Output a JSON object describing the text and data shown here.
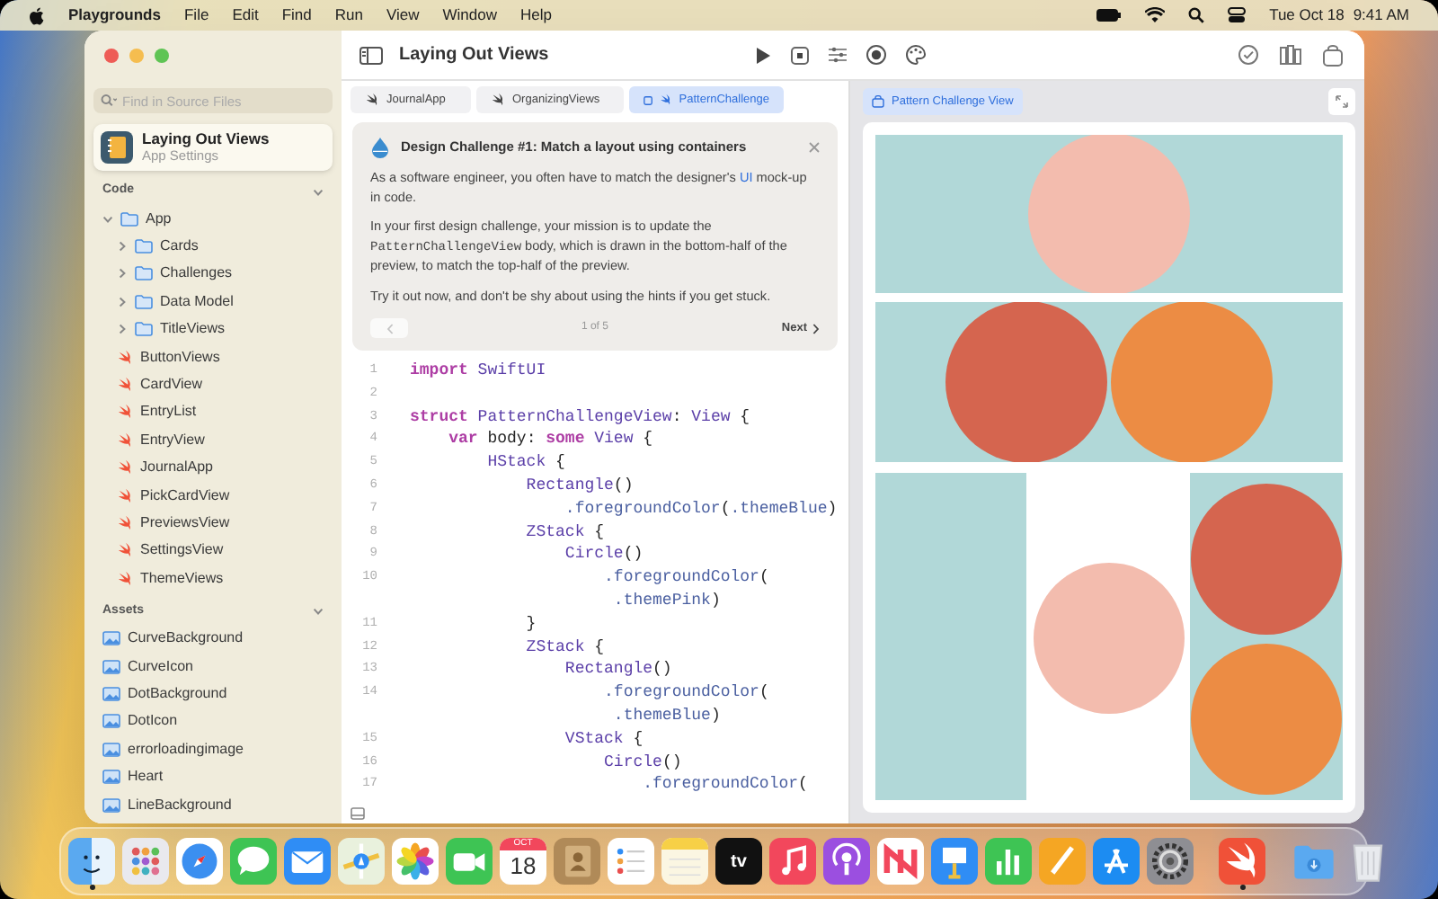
{
  "menu_bar": {
    "app_name": "Playgrounds",
    "menus": [
      "File",
      "Edit",
      "Find",
      "Run",
      "View",
      "Window",
      "Help"
    ],
    "date": "Tue Oct 18",
    "time": "9:41 AM"
  },
  "sidebar": {
    "search": {
      "placeholder": "Find in Source Files"
    },
    "project": {
      "title": "Laying Out Views",
      "subtitle": "App Settings",
      "selected": true
    },
    "sections": [
      {
        "title": "Code",
        "expanded": true,
        "items": [
          {
            "label": "App",
            "kind": "folder",
            "expanded": true,
            "children": [
              {
                "label": "Cards",
                "kind": "folder",
                "expanded": false
              },
              {
                "label": "Challenges",
                "kind": "folder",
                "expanded": false
              },
              {
                "label": "Data Model",
                "kind": "folder",
                "expanded": false
              },
              {
                "label": "TitleViews",
                "kind": "folder",
                "expanded": false
              },
              {
                "label": "ButtonViews",
                "kind": "file"
              },
              {
                "label": "CardView",
                "kind": "file"
              },
              {
                "label": "EntryList",
                "kind": "file"
              },
              {
                "label": "EntryView",
                "kind": "file"
              },
              {
                "label": "JournalApp",
                "kind": "file"
              },
              {
                "label": "PickCardView",
                "kind": "file"
              },
              {
                "label": "PreviewsView",
                "kind": "file"
              },
              {
                "label": "SettingsView",
                "kind": "file"
              },
              {
                "label": "ThemeViews",
                "kind": "file"
              }
            ]
          }
        ]
      },
      {
        "title": "Assets",
        "expanded": true,
        "items": [
          {
            "label": "CurveBackground",
            "kind": "image"
          },
          {
            "label": "CurveIcon",
            "kind": "image"
          },
          {
            "label": "DotBackground",
            "kind": "image"
          },
          {
            "label": "DotIcon",
            "kind": "image"
          },
          {
            "label": "errorloadingimage",
            "kind": "image"
          },
          {
            "label": "Heart",
            "kind": "image"
          },
          {
            "label": "LineBackground",
            "kind": "image"
          }
        ]
      }
    ]
  },
  "toolbar": {
    "title": "Laying Out Views"
  },
  "editor": {
    "tabs": [
      {
        "label": "JournalApp",
        "selected": false
      },
      {
        "label": "OrganizingViews",
        "selected": false
      },
      {
        "label": "PatternChallenge",
        "selected": true
      }
    ],
    "challenge": {
      "title": "Design Challenge #1: Match a layout using containers",
      "paragraphs": [
        [
          {
            "text": "As a software engineer, you often have to match the designer's "
          },
          {
            "text": "UI",
            "kind": "link"
          },
          {
            "text": " mock-up in code."
          }
        ],
        [
          {
            "text": "In your first design challenge, your mission is to update the "
          },
          {
            "text": "PatternChallengeView",
            "kind": "code"
          },
          {
            "text": " body, which is drawn in the bottom-half of the preview, to match the top-half of the preview."
          }
        ],
        [
          {
            "text": "Try it out now, and don't be shy about using the hints if you get stuck."
          }
        ]
      ],
      "back_disabled": true,
      "page": "1 of 5",
      "next": "Next"
    },
    "code_lines": [
      {
        "number": "1",
        "tokens": [
          {
            "kind": "keyword",
            "text": "import"
          },
          {
            "kind": "type",
            "text": " SwiftUI"
          }
        ]
      },
      {
        "number": "2"
      },
      {
        "number": "3",
        "tokens": [
          {
            "kind": "keyword",
            "text": "struct"
          },
          {
            "kind": "type",
            "text": " PatternChallengeView"
          },
          {
            "kind": "plain",
            "text": ": "
          },
          {
            "kind": "type",
            "text": "View"
          },
          {
            "kind": "plain",
            "text": " {"
          }
        ]
      },
      {
        "number": "4",
        "tokens": [
          {
            "kind": "keyword",
            "text": "    var"
          },
          {
            "kind": "plain",
            "text": " body: "
          },
          {
            "kind": "keyword",
            "text": "some"
          },
          {
            "kind": "type",
            "text": " View"
          },
          {
            "kind": "plain",
            "text": " {"
          }
        ]
      },
      {
        "number": "5",
        "tokens": [
          {
            "kind": "type",
            "text": "        HStack"
          },
          {
            "kind": "plain",
            "text": " {"
          }
        ]
      },
      {
        "number": "6",
        "tokens": [
          {
            "kind": "type",
            "text": "            Rectangle"
          },
          {
            "kind": "plain",
            "text": "()"
          }
        ]
      },
      {
        "number": "7",
        "tokens": [
          {
            "kind": "member",
            "text": "                .foregroundColor"
          },
          {
            "kind": "plain",
            "text": "("
          },
          {
            "kind": "member",
            "text": ".themeBlue"
          },
          {
            "kind": "plain",
            "text": ")"
          }
        ]
      },
      {
        "number": "8",
        "tokens": [
          {
            "kind": "type",
            "text": "            ZStack"
          },
          {
            "kind": "plain",
            "text": " {"
          }
        ]
      },
      {
        "number": "9",
        "tokens": [
          {
            "kind": "type",
            "text": "                Circle"
          },
          {
            "kind": "plain",
            "text": "()"
          }
        ]
      },
      {
        "number": "10",
        "tokens": [
          {
            "kind": "member",
            "text": "                    .foregroundColor"
          },
          {
            "kind": "plain",
            "text": "("
          }
        ]
      },
      {
        "tokens": [
          {
            "kind": "member",
            "text": "                     .themePink"
          },
          {
            "kind": "plain",
            "text": ")"
          }
        ]
      },
      {
        "number": "11",
        "tokens": [
          {
            "kind": "plain",
            "text": "            }"
          }
        ]
      },
      {
        "number": "12",
        "tokens": [
          {
            "kind": "type",
            "text": "            ZStack"
          },
          {
            "kind": "plain",
            "text": " {"
          }
        ]
      },
      {
        "number": "13",
        "tokens": [
          {
            "kind": "type",
            "text": "                Rectangle"
          },
          {
            "kind": "plain",
            "text": "()"
          }
        ]
      },
      {
        "number": "14",
        "tokens": [
          {
            "kind": "member",
            "text": "                    .foregroundColor"
          },
          {
            "kind": "plain",
            "text": "("
          }
        ]
      },
      {
        "tokens": [
          {
            "kind": "member",
            "text": "                     .themeBlue"
          },
          {
            "kind": "plain",
            "text": ")"
          }
        ]
      },
      {
        "number": "15",
        "tokens": [
          {
            "kind": "type",
            "text": "                VStack"
          },
          {
            "kind": "plain",
            "text": " {"
          }
        ]
      },
      {
        "number": "16",
        "tokens": [
          {
            "kind": "type",
            "text": "                    Circle"
          },
          {
            "kind": "plain",
            "text": "()"
          }
        ]
      },
      {
        "number": "17",
        "tokens": [
          {
            "kind": "member",
            "text": "                        .foregroundColor"
          },
          {
            "kind": "plain",
            "text": "("
          }
        ]
      }
    ]
  },
  "preview": {
    "tag": "Pattern Challenge View"
  },
  "dock": {
    "calendar_month": "OCT",
    "calendar_day": "18",
    "tv_label": "tv",
    "items": [
      {
        "running": true
      },
      {
        "running": false
      },
      {
        "running": false
      },
      {
        "running": false
      },
      {
        "running": false
      },
      {
        "running": false
      },
      {
        "running": false
      },
      {
        "running": false
      },
      {
        "running": false
      },
      {
        "running": false
      },
      {
        "running": false
      },
      {
        "running": false
      },
      {
        "running": false
      },
      {
        "running": false
      },
      {
        "running": false
      },
      {
        "running": false
      },
      {
        "running": false
      },
      {
        "running": false
      },
      {
        "running": false
      },
      {
        "running": false
      },
      {
        "running": false
      },
      {
        "running": true
      },
      {
        "running": false
      },
      {
        "running": false
      }
    ]
  }
}
